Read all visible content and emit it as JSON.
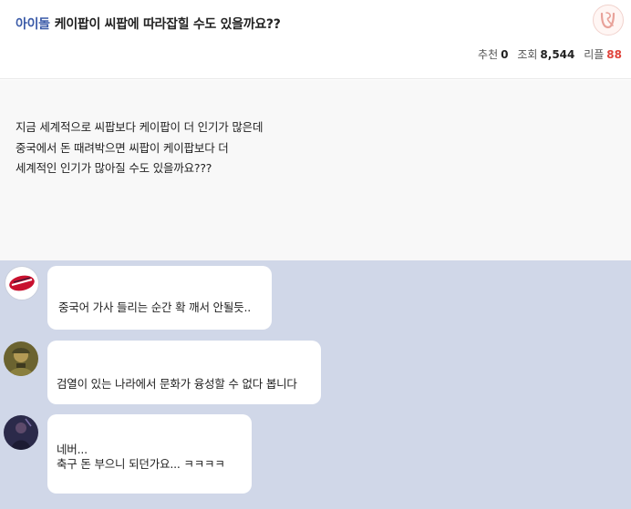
{
  "post": {
    "category": "아이돌",
    "title": "케이팝이 씨팝에 따라잡힐 수도 있을까요??",
    "stats": {
      "recommend_label": "추천",
      "recommend_count": "0",
      "views_label": "조회",
      "views_count": "8,544",
      "replies_label": "리플",
      "replies_count": "88"
    },
    "body_lines": [
      "지금 세계적으로 씨팝보다 케이팝이 더 인기가 많은데",
      "중국에서 돈 때려박으면 씨팝이 케이팝보다 더",
      "세계적인 인기가 많아질 수도 있을까요???"
    ]
  },
  "comments": [
    {
      "avatar_icon": "tigers-logo-icon",
      "lines": [
        "중국어 가사 들리는 순간 확 깨서 안될듯.."
      ]
    },
    {
      "avatar_icon": "soldier-avatar-icon",
      "lines": [
        "검열이 있는 나라에서 문화가 융성할 수 없다 봅니다"
      ]
    },
    {
      "avatar_icon": "dark-figure-avatar-icon",
      "lines": [
        "네버...",
        "축구 돈 부으니 되던가요... ㅋㅋㅋㅋ"
      ]
    }
  ],
  "colors": {
    "category": "#3a5aa8",
    "reply_count": "#e0443c",
    "comment_background": "#d0d7e8",
    "body_background": "#f8f8f8"
  }
}
